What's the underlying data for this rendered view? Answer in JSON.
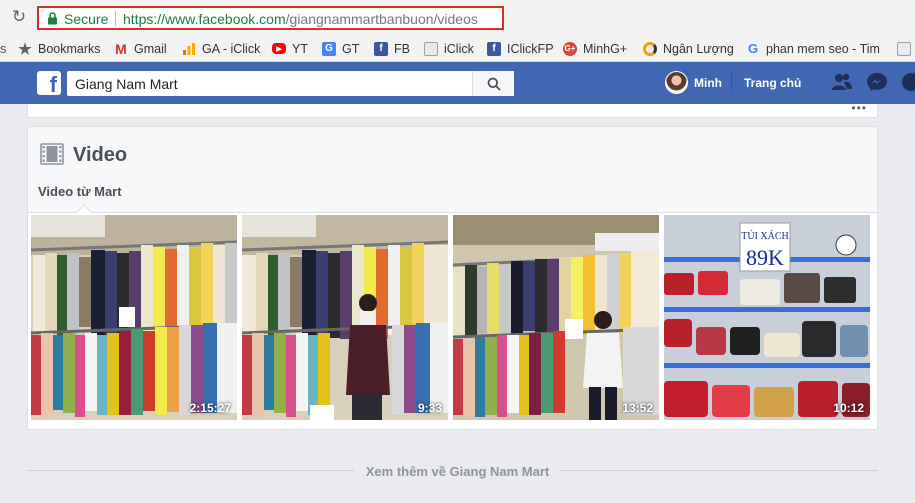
{
  "browser": {
    "secure_label": "Secure",
    "url_host": "https://www.facebook.com",
    "url_path": "/giangnammartbanbuon/videos"
  },
  "bookmarks": [
    {
      "label": "Bookmarks",
      "icon": "star-icon",
      "color": "#5f6368"
    },
    {
      "label": "Gmail",
      "icon": "gmail-icon",
      "color": "#d93025"
    },
    {
      "label": "GA - iClick",
      "icon": "analytics-icon",
      "color": "#f9ab00"
    },
    {
      "label": "YT",
      "icon": "youtube-icon",
      "color": "#ff0000"
    },
    {
      "label": "GT",
      "icon": "google-translate-icon",
      "color": "#4285f4"
    },
    {
      "label": "FB",
      "icon": "facebook-icon",
      "color": "#3b5998"
    },
    {
      "label": "iClick",
      "icon": "page-icon",
      "color": "#9aa0a6"
    },
    {
      "label": "IClickFP",
      "icon": "facebook-icon",
      "color": "#3b5998"
    },
    {
      "label": "MinhG+",
      "icon": "google-plus-icon",
      "color": "#db4437"
    },
    {
      "label": "Ngân Lượng",
      "icon": "nganluong-icon",
      "color": "#f39c12"
    },
    {
      "label": "phan mem seo - Tim",
      "icon": "google-icon",
      "color": "#4285f4"
    }
  ],
  "facebook": {
    "search_value": "Giang Nam Mart",
    "user_name": "Minh",
    "home_label": "Trang chủ"
  },
  "video_section": {
    "title": "Video",
    "subtab": "Video từ Mart",
    "videos": [
      {
        "duration": "2:15:27"
      },
      {
        "duration": "9:33"
      },
      {
        "duration": "13:52"
      },
      {
        "duration": "10:12"
      }
    ],
    "bag_sign_top": "TÚI XÁCH",
    "bag_sign_price": "89K",
    "see_more": "Xem thêm về Giang Nam Mart"
  },
  "colors": {
    "fb_blue": "#4267b2",
    "page_bg": "#e9ebee",
    "secure_green": "#188038",
    "highlight_red": "#d93025"
  }
}
